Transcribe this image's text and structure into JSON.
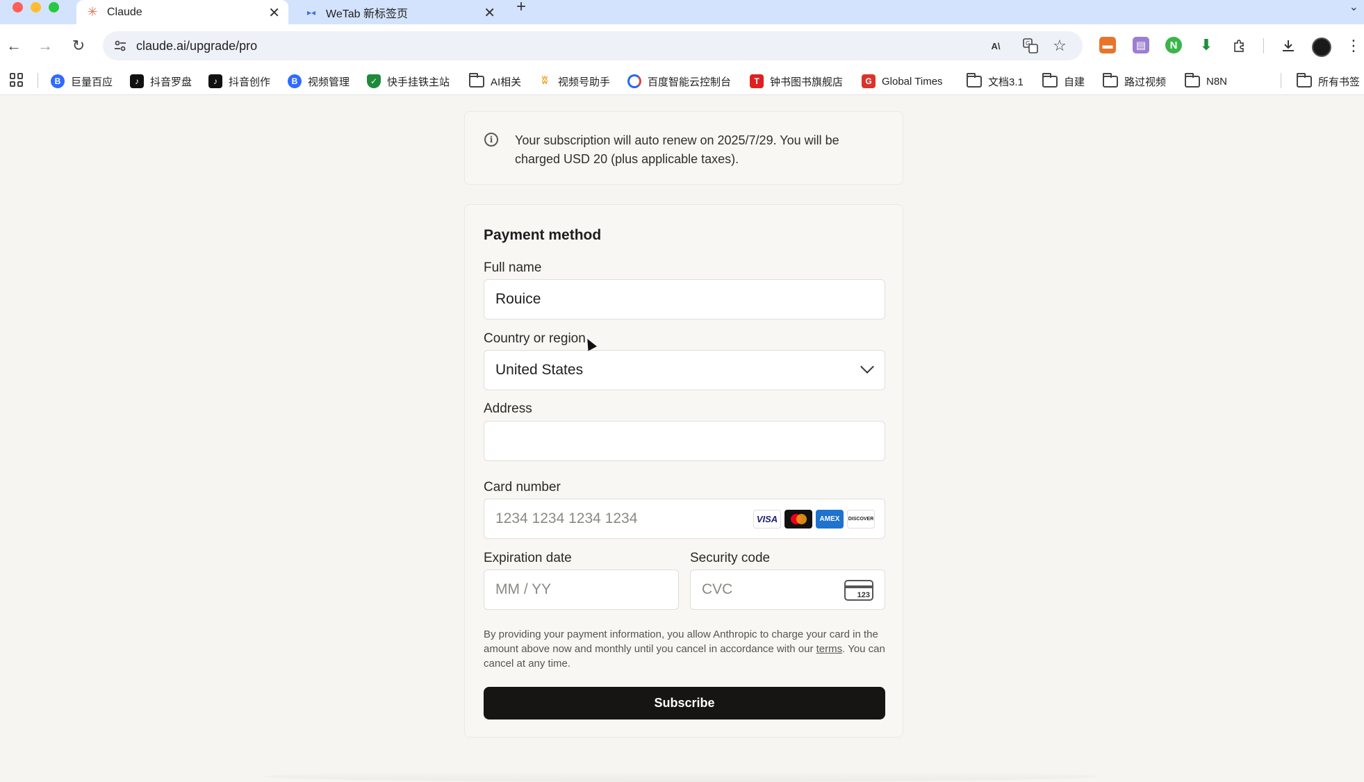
{
  "browser": {
    "tabs": [
      {
        "title": "Claude",
        "active": true,
        "icon": "claude-sparkle-icon"
      },
      {
        "title": "WeTab 新标签页",
        "active": false,
        "icon": "wetab-icon"
      }
    ],
    "new_tab": "+",
    "url": "claude.ai/upgrade/pro",
    "accent_color": "#d3e3fd"
  },
  "bookmarks": [
    {
      "label": "巨量百应",
      "icon": "b-blue-icon",
      "color": "#2f6bff"
    },
    {
      "label": "抖音罗盘",
      "icon": "tiktok-icon",
      "color": "#111111"
    },
    {
      "label": "抖音创作",
      "icon": "tiktok-icon",
      "color": "#111111"
    },
    {
      "label": "视频管理",
      "icon": "b-blue-icon",
      "color": "#2f6bff"
    },
    {
      "label": "快手挂铁主站",
      "icon": "shield-icon",
      "color": "#1f8a3b"
    },
    {
      "label": "AI相关",
      "icon": "folder-icon"
    },
    {
      "label": "视频号助手",
      "icon": "channels-icon",
      "color": "#f0a020"
    },
    {
      "label": "百度智能云控制台",
      "icon": "baidu-cloud-icon",
      "color": "#2468f2"
    },
    {
      "label": "钟书图书旗舰店",
      "icon": "t-red-icon",
      "color": "#e02020"
    },
    {
      "label": "Global Times",
      "icon": "g-red-icon",
      "color": "#d9342b"
    },
    {
      "label": "文档3.1",
      "icon": "folder-icon"
    },
    {
      "label": "自建",
      "icon": "folder-icon"
    },
    {
      "label": "路过视频",
      "icon": "folder-icon"
    },
    {
      "label": "N8N",
      "icon": "folder-icon"
    },
    {
      "label": "所有书签",
      "icon": "folder-icon"
    }
  ],
  "notice": {
    "text": "Your subscription will auto renew on 2025/7/29. You will be charged USD 20 (plus applicable taxes)."
  },
  "payment": {
    "title": "Payment method",
    "full_name_label": "Full name",
    "full_name_value": "Rouice",
    "country_label": "Country or region",
    "country_value": "United States",
    "address_label": "Address",
    "address_value": "",
    "card_number_label": "Card number",
    "card_number_placeholder": "1234 1234 1234 1234",
    "card_brands": [
      "VISA",
      "Mastercard",
      "AMEX",
      "DISCOVER"
    ],
    "expiration_label": "Expiration date",
    "expiration_placeholder": "MM / YY",
    "security_label": "Security code",
    "security_placeholder": "CVC",
    "cvc_icon_text": "123",
    "legal_before": "By providing your payment information, you allow Anthropic to charge your card in the amount above now and monthly until you cancel in accordance with our ",
    "legal_link": "terms",
    "legal_after": ". You can cancel at any time.",
    "subscribe_label": "Subscribe"
  }
}
